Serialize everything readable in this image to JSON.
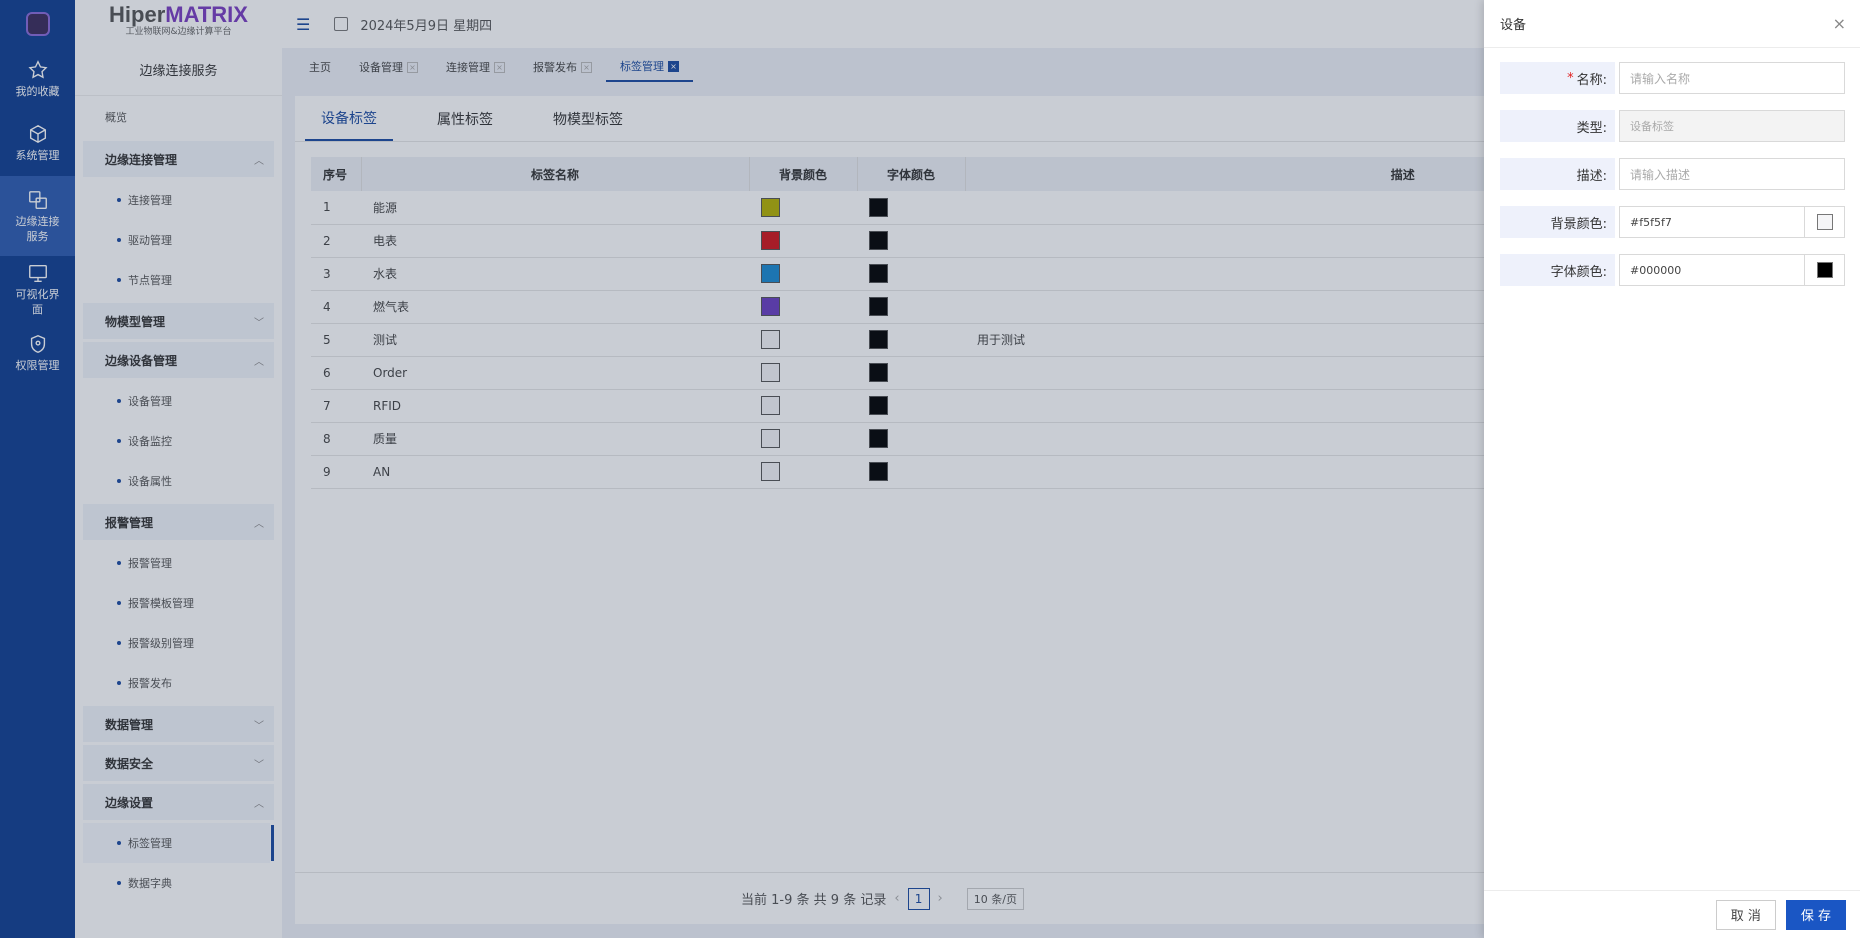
{
  "rail": {
    "items": [
      {
        "label": "我的收藏",
        "icon": "star-icon"
      },
      {
        "label": "系统管理",
        "icon": "cube-icon"
      },
      {
        "label": "边缘连接服务",
        "icon": "link-icon"
      },
      {
        "label": "可视化界面",
        "icon": "monitor-icon"
      },
      {
        "label": "权限管理",
        "icon": "shield-icon"
      }
    ]
  },
  "brand": {
    "name_plain": "Hiper",
    "name_bold": "MATRIX",
    "subtitle": "工业物联网&边缘计算平台"
  },
  "sidebar": {
    "title": "边缘连接服务",
    "overview": "概览",
    "groups": [
      {
        "label": "边缘连接管理",
        "chevron": "︿",
        "items": [
          "连接管理",
          "驱动管理",
          "节点管理"
        ]
      },
      {
        "label": "物模型管理",
        "chevron": "﹀",
        "items": []
      },
      {
        "label": "边缘设备管理",
        "chevron": "︿",
        "items": [
          "设备管理",
          "设备监控",
          "设备属性"
        ]
      },
      {
        "label": "报警管理",
        "chevron": "︿",
        "items": [
          "报警管理",
          "报警模板管理",
          "报警级别管理",
          "报警发布"
        ]
      },
      {
        "label": "数据管理",
        "chevron": "﹀",
        "items": []
      },
      {
        "label": "数据安全",
        "chevron": "﹀",
        "items": []
      },
      {
        "label": "边缘设置",
        "chevron": "︿",
        "items": [
          "标签管理",
          "数据字典"
        ]
      }
    ]
  },
  "header": {
    "date": "2024年5月9日 星期四"
  },
  "tabs": [
    "主页",
    "设备管理",
    "连接管理",
    "报警发布",
    "标签管理"
  ],
  "subtabs": [
    "设备标签",
    "属性标签",
    "物模型标签"
  ],
  "table": {
    "headers": {
      "idx": "序号",
      "name": "标签名称",
      "bg": "背景颜色",
      "fg": "字体颜色",
      "desc": "描述"
    },
    "rows": [
      {
        "idx": "1",
        "name": "能源",
        "bg": "#b5b100",
        "fg": "#000000",
        "desc": ""
      },
      {
        "idx": "2",
        "name": "电表",
        "bg": "#d0141a",
        "fg": "#000000",
        "desc": ""
      },
      {
        "idx": "3",
        "name": "水表",
        "bg": "#1a8ad0",
        "fg": "#000000",
        "desc": ""
      },
      {
        "idx": "4",
        "name": "燃气表",
        "bg": "#6a3ec0",
        "fg": "#000000",
        "desc": ""
      },
      {
        "idx": "5",
        "name": "测试",
        "bg": "#f5f5f7",
        "fg": "#000000",
        "desc": "用于测试"
      },
      {
        "idx": "6",
        "name": "Order",
        "bg": "#f5f5f7",
        "fg": "#000000",
        "desc": ""
      },
      {
        "idx": "7",
        "name": "RFID",
        "bg": "#f5f5f7",
        "fg": "#000000",
        "desc": ""
      },
      {
        "idx": "8",
        "name": "质量",
        "bg": "#f5f5f7",
        "fg": "#000000",
        "desc": ""
      },
      {
        "idx": "9",
        "name": "AN",
        "bg": "#f5f5f7",
        "fg": "#000000",
        "desc": ""
      }
    ]
  },
  "pager": {
    "summary": "当前 1-9 条 共 9 条 记录",
    "page": "1",
    "size": "10 条/页"
  },
  "drawer": {
    "title": "设备",
    "name_label": "名称:",
    "name_placeholder": "请输入名称",
    "type_label": "类型:",
    "type_value": "设备标签",
    "desc_label": "描述:",
    "desc_placeholder": "请输入描述",
    "bg_label": "背景颜色:",
    "bg_value": "#f5f5f7",
    "fg_label": "字体颜色:",
    "fg_value": "#000000",
    "cancel": "取 消",
    "save": "保 存"
  },
  "colors": {
    "primary": "#1a4aa0",
    "rail": "#0f3e91",
    "save": "#1a56c4"
  }
}
